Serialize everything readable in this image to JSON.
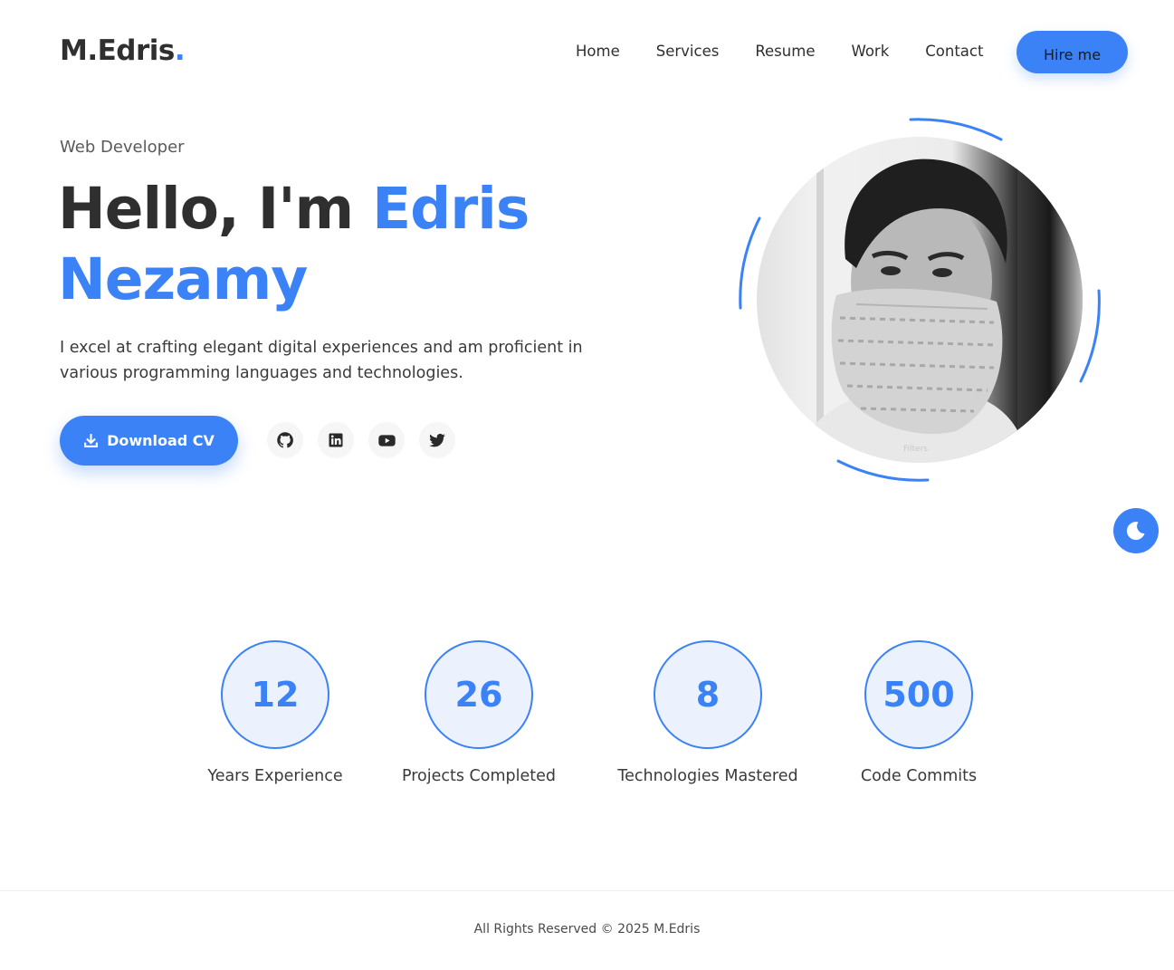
{
  "header": {
    "logo": {
      "text": "M.Edris",
      "dot": "."
    },
    "nav": [
      "Home",
      "Services",
      "Resume",
      "Work",
      "Contact"
    ],
    "hire_label": "Hire me"
  },
  "hero": {
    "subtitle": "Web Developer",
    "title_prefix": "Hello, I'm ",
    "title_name": "Edris Nezamy",
    "description": "I excel at crafting elegant digital experiences and am proficient in various programming languages and technologies.",
    "download_label": "Download CV",
    "socials": [
      "github-icon",
      "linkedin-icon",
      "youtube-icon",
      "twitter-icon"
    ],
    "avatar_caption": "Filters"
  },
  "stats": [
    {
      "value": "12",
      "label": "Years Experience"
    },
    {
      "value": "26",
      "label": "Projects Completed"
    },
    {
      "value": "8",
      "label": "Technologies Mastered"
    },
    {
      "value": "500",
      "label": "Code Commits"
    }
  ],
  "footer": {
    "text": "All Rights Reserved © 2025 M.Edris"
  },
  "colors": {
    "accent": "#3b82f6",
    "text": "#2f2f2f",
    "stat_bg": "#ebf2fe"
  }
}
